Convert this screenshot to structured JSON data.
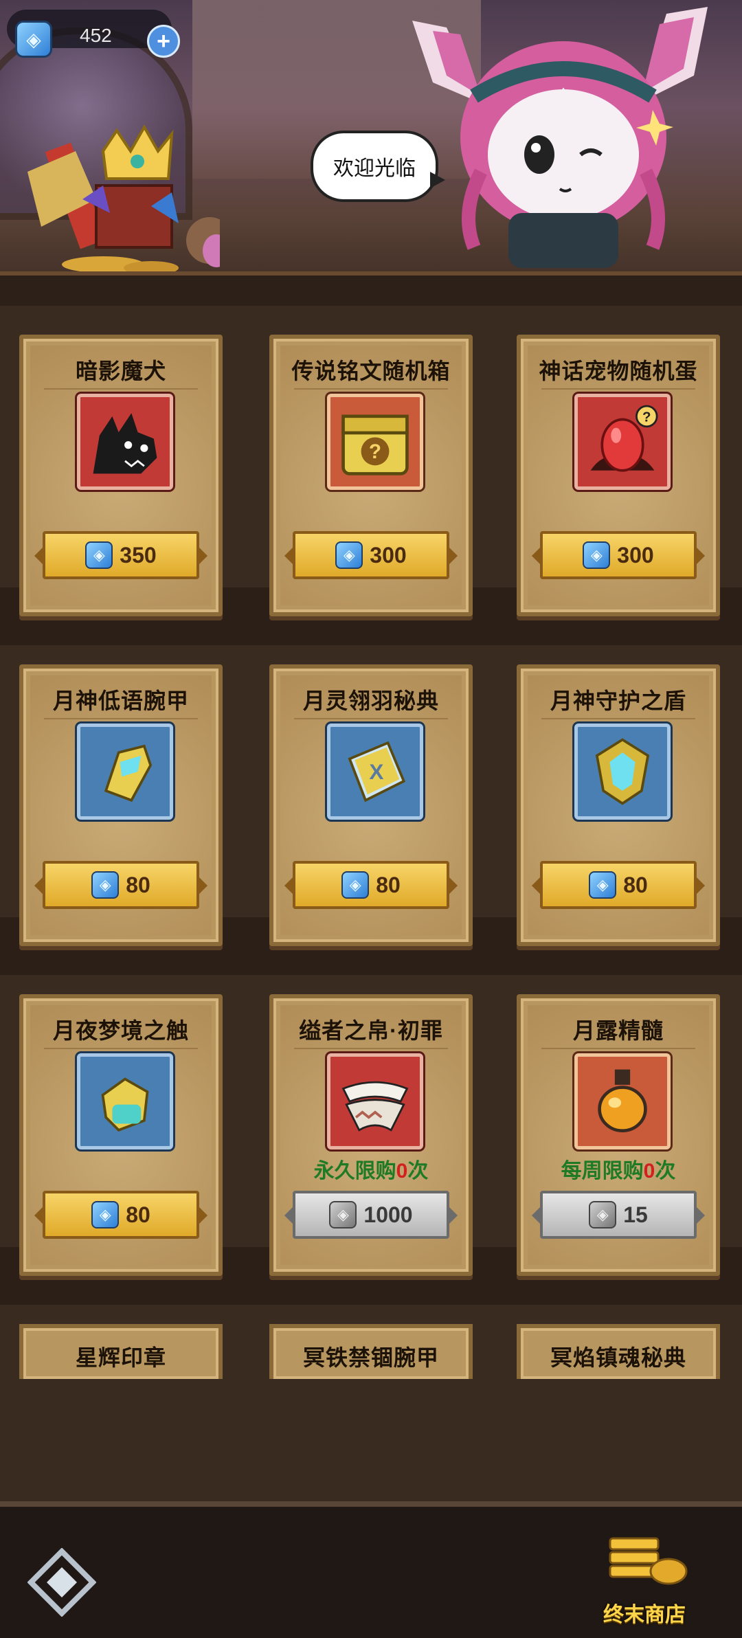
{
  "header": {
    "currency_value": "452",
    "currency_icon": "crystal-icon",
    "add_label": "+",
    "speech": "欢迎光临"
  },
  "items": [
    {
      "title": "暗影魔犬",
      "icon": "shadow-hound-icon",
      "frame": "red",
      "price": "350",
      "price_style": "gold",
      "limit": null
    },
    {
      "title": "传说铭文随机箱",
      "icon": "mystery-chest-icon",
      "frame": "orange",
      "price": "300",
      "price_style": "gold",
      "limit": null
    },
    {
      "title": "神话宠物随机蛋",
      "icon": "mystery-egg-icon",
      "frame": "red",
      "price": "300",
      "price_style": "gold",
      "limit": null
    },
    {
      "title": "月神低语腕甲",
      "icon": "bracer-icon",
      "frame": "blue",
      "price": "80",
      "price_style": "gold",
      "limit": null
    },
    {
      "title": "月灵翎羽秘典",
      "icon": "spellbook-icon",
      "frame": "blue",
      "price": "80",
      "price_style": "gold",
      "limit": null
    },
    {
      "title": "月神守护之盾",
      "icon": "shield-icon",
      "frame": "blue",
      "price": "80",
      "price_style": "gold",
      "limit": null
    },
    {
      "title": "月夜梦境之触",
      "icon": "gauntlet-icon",
      "frame": "blue",
      "price": "80",
      "price_style": "gold",
      "limit": null
    },
    {
      "title": "缢者之帛·初罪",
      "icon": "silk-scarf-icon",
      "frame": "red",
      "price": "1000",
      "price_style": "silver",
      "limit": {
        "prefix": "永久限购",
        "count": "0",
        "suffix": "次"
      }
    },
    {
      "title": "月露精髓",
      "icon": "potion-icon",
      "frame": "orange",
      "price": "15",
      "price_style": "silver",
      "limit": {
        "prefix": "每周限购",
        "count": "0",
        "suffix": "次"
      }
    }
  ],
  "partial_items": [
    "星辉印章",
    "冥铁禁锢腕甲",
    "冥焰镇魂秘典"
  ],
  "nav": {
    "left_icon": "emblem-icon",
    "right_icon": "coin-stack-icon",
    "right_label": "终末商店"
  },
  "colors": {
    "limit_green": "#1e7a25",
    "limit_zero_red": "#d02020",
    "nav_label_gold": "#ffd54a"
  }
}
